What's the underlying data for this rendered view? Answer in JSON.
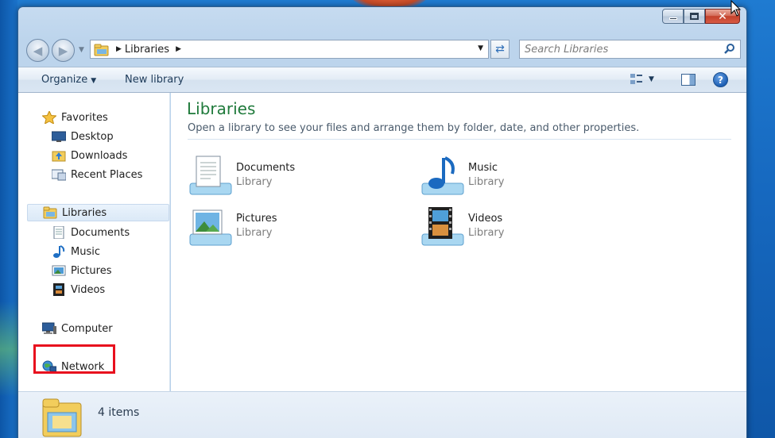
{
  "window": {
    "title": "Libraries"
  },
  "address": {
    "crumb": "Libraries"
  },
  "search": {
    "placeholder": "Search Libraries"
  },
  "toolbar": {
    "organize_label": "Organize",
    "new_library_label": "New library"
  },
  "sidebar": {
    "favorites": {
      "label": "Favorites",
      "items": [
        {
          "label": "Desktop",
          "icon": "desktop-icon"
        },
        {
          "label": "Downloads",
          "icon": "downloads-icon"
        },
        {
          "label": "Recent Places",
          "icon": "recent-places-icon"
        }
      ]
    },
    "libraries": {
      "label": "Libraries",
      "items": [
        {
          "label": "Documents",
          "icon": "documents-icon"
        },
        {
          "label": "Music",
          "icon": "music-icon"
        },
        {
          "label": "Pictures",
          "icon": "pictures-icon"
        },
        {
          "label": "Videos",
          "icon": "videos-icon"
        }
      ]
    },
    "computer": {
      "label": "Computer"
    },
    "network": {
      "label": "Network"
    }
  },
  "content": {
    "title": "Libraries",
    "subtitle": "Open a library to see your files and arrange them by folder, date, and other properties.",
    "libraries": [
      {
        "name": "Documents",
        "type": "Library",
        "icon": "documents-library-icon"
      },
      {
        "name": "Music",
        "type": "Library",
        "icon": "music-library-icon"
      },
      {
        "name": "Pictures",
        "type": "Library",
        "icon": "pictures-library-icon"
      },
      {
        "name": "Videos",
        "type": "Library",
        "icon": "videos-library-icon"
      }
    ]
  },
  "details": {
    "count": "4 items"
  },
  "colors": {
    "title_green": "#1f7a3b",
    "highlight_red": "#e8101e",
    "selection": "#dbe9f7"
  }
}
